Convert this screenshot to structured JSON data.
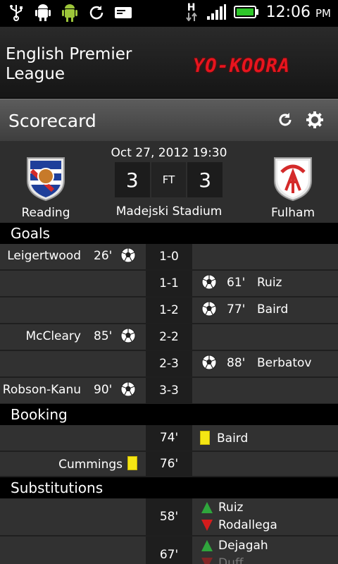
{
  "status_bar": {
    "icons_left": [
      "usb-icon",
      "android-debug-icon",
      "android-icon",
      "sync-icon",
      "message-icon"
    ],
    "network": "H",
    "time": "12:06",
    "ampm": "PM"
  },
  "app": {
    "title": "English Premier League",
    "logo_text": "YO-KOORA"
  },
  "section": {
    "title": "Scorecard",
    "refresh_icon": "refresh-icon",
    "settings_icon": "gear-icon"
  },
  "match": {
    "datetime": "Oct 27, 2012 19:30",
    "home_team": "Reading",
    "away_team": "Fulham",
    "home_score": "3",
    "away_score": "3",
    "status": "FT",
    "stadium": "Madejski Stadium"
  },
  "goals": {
    "label": "Goals",
    "rows": [
      {
        "home_player": "Leigertwood",
        "home_minute": "26'",
        "score": "1-0",
        "away_player": "",
        "away_minute": ""
      },
      {
        "home_player": "",
        "home_minute": "",
        "score": "1-1",
        "away_player": "Ruiz",
        "away_minute": "61'"
      },
      {
        "home_player": "",
        "home_minute": "",
        "score": "1-2",
        "away_player": "Baird",
        "away_minute": "77'"
      },
      {
        "home_player": "McCleary",
        "home_minute": "85'",
        "score": "2-2",
        "away_player": "",
        "away_minute": ""
      },
      {
        "home_player": "",
        "home_minute": "",
        "score": "2-3",
        "away_player": "Berbatov",
        "away_minute": "88'"
      },
      {
        "home_player": "Robson-Kanu",
        "home_minute": "90'",
        "score": "3-3",
        "away_player": "",
        "away_minute": ""
      }
    ]
  },
  "booking": {
    "label": "Booking",
    "rows": [
      {
        "minute": "74'",
        "home_player": "",
        "away_player": "Baird",
        "card": "yellow"
      },
      {
        "minute": "76'",
        "home_player": "Cummings",
        "away_player": "",
        "card": "yellow"
      }
    ]
  },
  "substitutions": {
    "label": "Substitutions",
    "rows": [
      {
        "minute": "58'",
        "player_in": "Ruiz",
        "player_out": "Rodallega"
      },
      {
        "minute": "67'",
        "player_in": "Dejagah",
        "player_out": "Duff"
      }
    ]
  },
  "colors": {
    "accent_logo": "#e8141e",
    "yellow_card": "#f5e614",
    "sub_in": "#2fa63c",
    "sub_out": "#d41c1c"
  }
}
